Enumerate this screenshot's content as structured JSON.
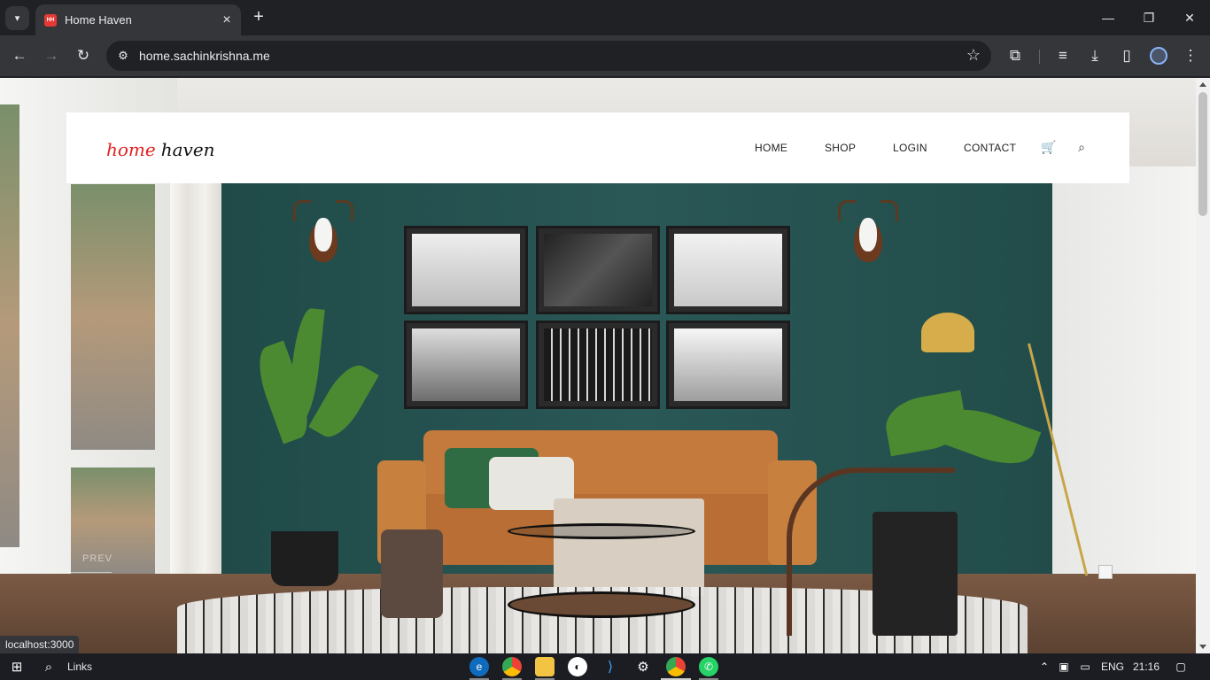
{
  "browser": {
    "tab_title": "Home Haven",
    "favicon_text": "HH",
    "url": "home.sachinkrishna.me",
    "status_url": "localhost:3000"
  },
  "site": {
    "logo_part1": "home",
    "logo_part2": "haven",
    "nav": [
      "HOME",
      "SHOP",
      "LOGIN",
      "CONTACT"
    ],
    "icons": [
      "cart-icon",
      "search-icon"
    ],
    "slider_prev": "PREV"
  },
  "taskbar": {
    "search_label": "Links",
    "language": "ENG",
    "time": "21:16"
  },
  "colors": {
    "logo_accent": "#e02020",
    "wall": "#2a5856",
    "sofa": "#c47a3d"
  }
}
